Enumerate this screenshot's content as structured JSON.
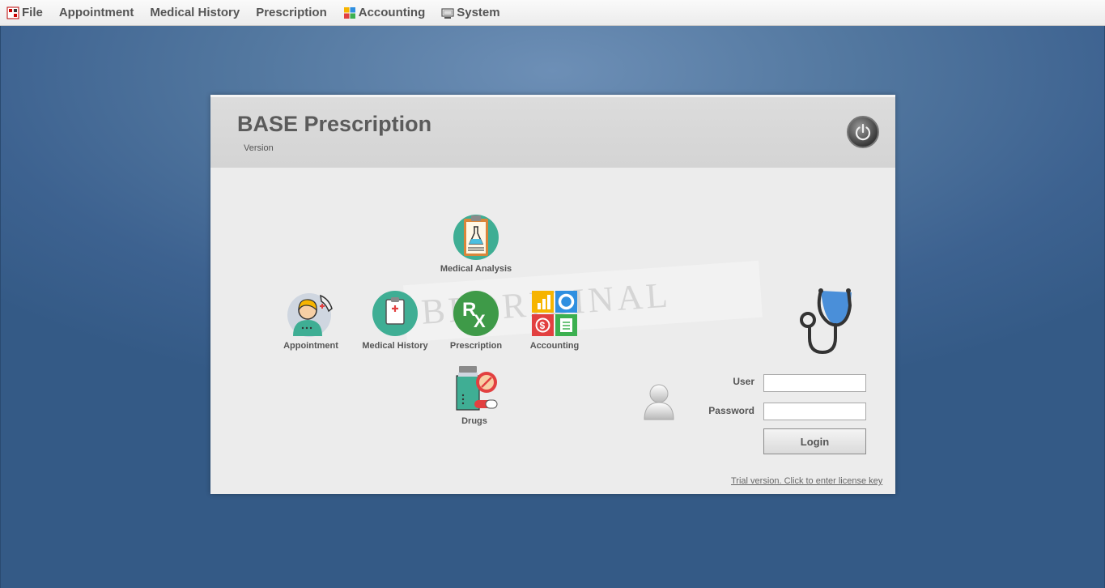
{
  "menubar": {
    "items": [
      {
        "label": "File",
        "icon": "app-logo-icon"
      },
      {
        "label": "Appointment",
        "icon": ""
      },
      {
        "label": "Medical History",
        "icon": ""
      },
      {
        "label": "Prescription",
        "icon": ""
      },
      {
        "label": "Accounting",
        "icon": "accounting-icon"
      },
      {
        "label": "System",
        "icon": "system-icon"
      }
    ]
  },
  "panel": {
    "title": "BASE Prescription",
    "version": "Version",
    "watermark": "BEORIGINAL"
  },
  "modules": {
    "medical_analysis": "Medical Analysis",
    "appointment": "Appointment",
    "medical_history": "Medical History",
    "prescription": "Prescription",
    "accounting": "Accounting",
    "drugs": "Drugs"
  },
  "login": {
    "user_label": "User",
    "password_label": "Password",
    "user_value": "",
    "password_value": "",
    "button": "Login"
  },
  "license_link": "Trial version. Click to enter license key",
  "colors": {
    "desktop": "#3d6290",
    "panel": "#ececec",
    "header": "#d8d8d8",
    "teal": "#3fae94",
    "green": "#3e9a48"
  }
}
